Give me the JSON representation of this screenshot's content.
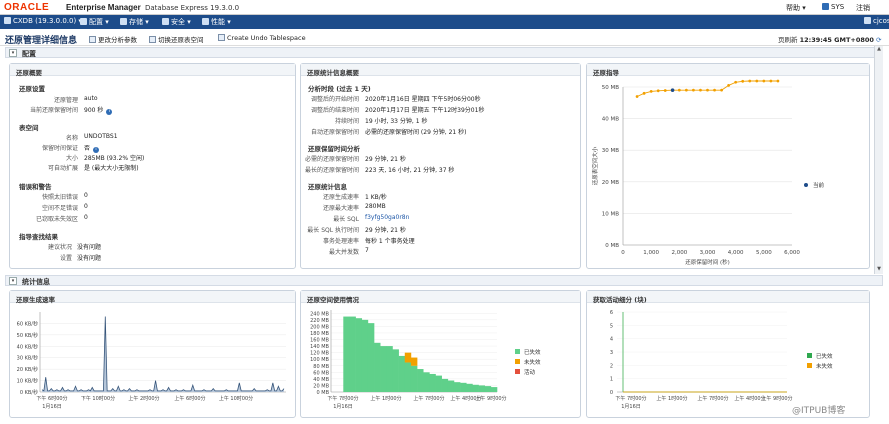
{
  "header": {
    "logo": "ORACLE",
    "product": "Enterprise Manager",
    "db_version": "Database Express 19.3.0.0",
    "help": "帮助",
    "user": "SYS",
    "logout": "注销"
  },
  "menubar": {
    "container": "CXDB (19.3.0.0.0)",
    "items": [
      "配置",
      "存储",
      "安全",
      "性能"
    ],
    "right_user": "cjcos"
  },
  "page": {
    "title": "还原管理详细信息",
    "buttons": [
      "更改分析参数",
      "切换还原表空间",
      "Create Undo Tablespace"
    ],
    "refreshed_label": "页刷新",
    "refreshed_time": "12:39:45 GMT+0800"
  },
  "config_section": {
    "title": "配置"
  },
  "undo_summary": {
    "title": "还原概要",
    "settings_title": "还原设置",
    "settings": [
      {
        "label": "还原管理",
        "value": "auto"
      },
      {
        "label": "当前还原保留时间",
        "value": "900 秒"
      }
    ],
    "tablespace_title": "表空间",
    "tablespace": [
      {
        "label": "名称",
        "value": "UNDOTBS1"
      },
      {
        "label": "保留时间保证",
        "value": "否"
      },
      {
        "label": "大小",
        "value": "285MB (93.2% 空闲)"
      },
      {
        "label": "可自动扩展",
        "value": "是 (最大大小无限制)"
      }
    ],
    "errors_title": "错误和警告",
    "errors": [
      {
        "label": "快照太旧错误",
        "value": "0"
      },
      {
        "label": "空间不足错误",
        "value": "0"
      },
      {
        "label": "已窃取未失效区",
        "value": "0"
      }
    ],
    "guidance_title": "指导查找结果",
    "guidance": [
      {
        "label": "建议状况",
        "value": "没有问题"
      },
      {
        "label": "设置",
        "value": "没有问题"
      }
    ]
  },
  "undo_stats": {
    "title": "还原统计信息概要",
    "period_title": "分析时段 (过去 1 天)",
    "period": [
      {
        "label": "调整后的开始时间",
        "value": "2020年1月16日 星期四 下午5时06分00秒"
      },
      {
        "label": "调整后的结束时间",
        "value": "2020年1月17日 星期五 下午12时39分01秒"
      },
      {
        "label": "持续时间",
        "value": "19 小时, 33 分钟, 1 秒"
      },
      {
        "label": "自动还原保留时间",
        "value": "必需的还原保留时间 (29 分钟, 21 秒)"
      }
    ],
    "retention_title": "还原保留时间分析",
    "retention": [
      {
        "label": "必需的还原保留时间",
        "value": "29 分钟, 21 秒"
      },
      {
        "label": "最长的还原保留时间",
        "value": "223 天, 16 小时, 21 分钟, 37 秒"
      }
    ],
    "stats_title": "还原统计信息",
    "stats": [
      {
        "label": "还原生成速率",
        "value": "1 KB/秒"
      },
      {
        "label": "还原最大速率",
        "value": "280MB"
      },
      {
        "label": "最长 SQL",
        "value": "f3yfg50ga0r8n"
      },
      {
        "label": "最长 SQL 执行时间",
        "value": "29 分钟, 21 秒"
      },
      {
        "label": "事务处理速率",
        "value": "每秒 1 个事务处理"
      },
      {
        "label": "最大并发数",
        "value": "7"
      }
    ]
  },
  "advisor": {
    "title": "还原指导"
  },
  "stats_section": {
    "title": "统计信息"
  },
  "gen_rate": {
    "title": "还原生成速率"
  },
  "space_usage": {
    "title": "还原空间使用情况"
  },
  "active_sessions": {
    "title": "获取活动细分 (块)"
  },
  "watermark": "@ITPUB博客",
  "chart_data": [
    {
      "type": "line",
      "title": "还原指导",
      "xlabel": "还原保留时间 (秒)",
      "ylabel": "还原表空间大小",
      "xlim": [
        0,
        6000
      ],
      "ylim": [
        0,
        50
      ],
      "x_ticks": [
        "0",
        "1,000",
        "2,000",
        "3,000",
        "4,000",
        "5,000",
        "6,000"
      ],
      "y_ticks": [
        "0 MB",
        "10 MB",
        "20 MB",
        "30 MB",
        "40 MB",
        "50 MB"
      ],
      "series": [
        {
          "name": "",
          "color": "#f2a000",
          "x": [
            500,
            750,
            1000,
            1250,
            1500,
            1760,
            2000,
            2250,
            2500,
            2750,
            3000,
            3250,
            3500,
            3750,
            4000,
            4250,
            4500,
            4750,
            5000,
            5250,
            5500
          ],
          "values": [
            47,
            48,
            48.6,
            48.8,
            48.9,
            49,
            49,
            49,
            49,
            49,
            49,
            49,
            49,
            50.5,
            51.5,
            51.8,
            51.9,
            51.9,
            51.9,
            51.9,
            51.9
          ]
        }
      ],
      "point": {
        "name": "当前",
        "x": 1760,
        "y": 49
      },
      "legend": [
        "当前"
      ]
    },
    {
      "type": "line",
      "title": "还原生成速率",
      "y_ticks": [
        "0 KB/秒",
        "10 KB/秒",
        "20 KB/秒",
        "30 KB/秒",
        "40 KB/秒",
        "50 KB/秒",
        "60 KB/秒"
      ],
      "ylim": [
        0,
        70
      ],
      "x_ticks": [
        "下午 6时00分",
        "下午 10时00分",
        "上午 2时00分",
        "上午 6时00分",
        "上午 10时00分"
      ],
      "x_date": "1月16日",
      "series": [
        {
          "name": "",
          "color": "#36557a",
          "values": [
            2,
            1,
            13,
            1,
            1,
            3,
            1,
            1,
            2,
            1,
            1,
            4,
            1,
            1,
            2,
            1,
            1,
            1,
            5,
            1,
            1,
            2,
            1,
            1,
            1,
            2,
            1,
            4,
            1,
            1,
            1,
            1,
            1,
            1,
            66,
            1,
            1,
            1,
            3,
            1,
            1,
            5,
            1,
            1,
            2,
            1,
            1,
            3,
            1,
            1,
            1,
            2,
            1,
            1,
            1,
            1,
            1,
            1,
            2,
            1,
            1,
            10,
            1,
            1,
            1,
            2,
            1,
            1,
            4,
            1,
            1,
            1,
            2,
            1,
            1,
            1,
            2,
            1,
            1,
            1,
            1,
            6,
            1,
            1,
            1,
            1,
            1,
            2,
            1,
            1,
            1,
            1,
            3,
            1,
            1,
            1,
            1,
            1,
            1,
            2,
            1,
            1,
            1,
            1,
            1,
            1,
            8,
            1,
            1,
            1,
            1,
            1,
            1,
            1,
            3,
            1,
            1,
            1,
            1,
            1,
            1,
            2,
            1,
            1,
            8,
            1,
            1,
            5,
            1,
            1,
            3
          ]
        }
      ]
    },
    {
      "type": "area",
      "title": "还原空间使用情况",
      "y_ticks": [
        "0 MB",
        "20 MB",
        "40 MB",
        "60 MB",
        "80 MB",
        "100 MB",
        "120 MB",
        "140 MB",
        "160 MB",
        "180 MB",
        "200 MB",
        "220 MB",
        "240 MB"
      ],
      "ylim": [
        0,
        250
      ],
      "x_ticks": [
        "下午 7时00分",
        "上午 1时00分",
        "上午 7时00分",
        "上午 4时00分",
        "上午 9时00分"
      ],
      "x_date": "1月16日",
      "series": [
        {
          "name": "已失效",
          "color": "#5fd08a",
          "values": [
            0,
            0,
            230,
            230,
            225,
            220,
            210,
            150,
            140,
            140,
            130,
            110,
            90,
            80,
            70,
            60,
            55,
            50,
            40,
            35,
            30,
            28,
            25,
            22,
            20,
            18,
            15
          ]
        },
        {
          "name": "未失效",
          "color": "#f2a000",
          "values": [
            0,
            0,
            0,
            0,
            0,
            0,
            0,
            0,
            0,
            0,
            0,
            0,
            30,
            25,
            0,
            0,
            0,
            0,
            0,
            0,
            0,
            0,
            0,
            0,
            0,
            0,
            0
          ]
        },
        {
          "name": "活动",
          "color": "#e4503c",
          "values": [
            0,
            0,
            0,
            0,
            0,
            0,
            0,
            0,
            0,
            0,
            0,
            0,
            0,
            0,
            0,
            0,
            0,
            0,
            0,
            0,
            0,
            0,
            0,
            0,
            0,
            0,
            0
          ]
        }
      ]
    },
    {
      "type": "line",
      "title": "获取活动细分 (块)",
      "y_ticks": [
        "0",
        "1",
        "2",
        "3",
        "4",
        "5",
        "6"
      ],
      "ylim": [
        0,
        6
      ],
      "x_ticks": [
        "下午 7时00分",
        "上午 1时00分",
        "上午 7时00分",
        "上午 4时00分",
        "上午 9时00分"
      ],
      "x_date": "1月16日",
      "series": [
        {
          "name": "已失效",
          "color": "#2fa84f",
          "values": [
            0,
            0,
            0,
            0,
            0,
            0,
            0,
            0,
            0,
            0,
            0,
            0,
            0,
            0,
            0,
            0,
            0,
            0,
            0,
            0
          ]
        },
        {
          "name": "未失效",
          "color": "#f2a000",
          "values": [
            0,
            0,
            0,
            0,
            0,
            0,
            0,
            0,
            0,
            0,
            0,
            0,
            0,
            0,
            0,
            0,
            0,
            0,
            0,
            0
          ]
        }
      ]
    }
  ]
}
